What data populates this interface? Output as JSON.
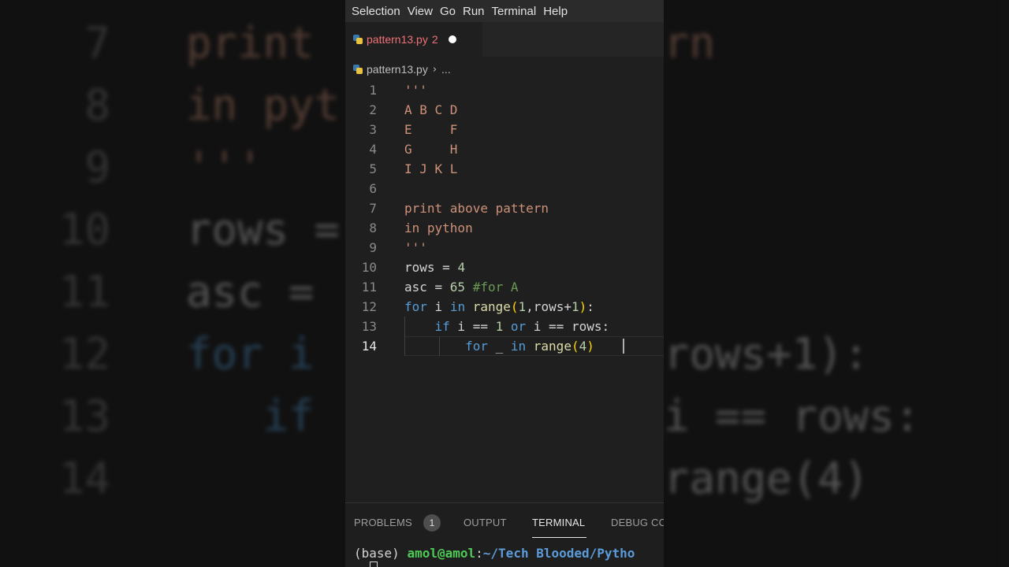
{
  "menu": [
    "Selection",
    "View",
    "Go",
    "Run",
    "Terminal",
    "Help"
  ],
  "tab": {
    "filename": "pattern13.py",
    "problems_count": "2"
  },
  "breadcrumb": {
    "file": "pattern13.py",
    "more": "..."
  },
  "active_line": 14,
  "code_lines": [
    {
      "n": "1",
      "tokens": [
        [
          "s-str",
          "'''"
        ]
      ]
    },
    {
      "n": "2",
      "tokens": [
        [
          "s-str",
          "A B C D"
        ]
      ]
    },
    {
      "n": "3",
      "tokens": [
        [
          "s-str",
          "E     F"
        ]
      ]
    },
    {
      "n": "4",
      "tokens": [
        [
          "s-str",
          "G     H"
        ]
      ]
    },
    {
      "n": "5",
      "tokens": [
        [
          "s-str",
          "I J K L"
        ]
      ]
    },
    {
      "n": "6",
      "tokens": []
    },
    {
      "n": "7",
      "tokens": [
        [
          "s-str",
          "print above pattern"
        ]
      ]
    },
    {
      "n": "8",
      "tokens": [
        [
          "s-str",
          "in python"
        ]
      ]
    },
    {
      "n": "9",
      "tokens": [
        [
          "s-str",
          "'''"
        ]
      ]
    },
    {
      "n": "10",
      "tokens": [
        [
          "s-txt",
          "rows = "
        ],
        [
          "s-num",
          "4"
        ]
      ]
    },
    {
      "n": "11",
      "tokens": [
        [
          "s-txt",
          "asc = "
        ],
        [
          "s-num",
          "65"
        ],
        [
          "s-txt",
          " "
        ],
        [
          "s-com",
          "#for A"
        ]
      ]
    },
    {
      "n": "12",
      "tokens": [
        [
          "s-kw",
          "for"
        ],
        [
          "s-txt",
          " i "
        ],
        [
          "s-kw",
          "in"
        ],
        [
          "s-txt",
          " "
        ],
        [
          "s-fn",
          "range"
        ],
        [
          "s-br1",
          "("
        ],
        [
          "s-num",
          "1"
        ],
        [
          "s-txt",
          ",rows+"
        ],
        [
          "s-num",
          "1"
        ],
        [
          "s-br1",
          ")"
        ],
        [
          "s-txt",
          ":"
        ]
      ]
    },
    {
      "n": "13",
      "tokens": [
        [
          "s-txt",
          "    "
        ],
        [
          "s-kw",
          "if"
        ],
        [
          "s-txt",
          " i == "
        ],
        [
          "s-num",
          "1"
        ],
        [
          "s-txt",
          " "
        ],
        [
          "s-kw",
          "or"
        ],
        [
          "s-txt",
          " i == rows:"
        ]
      ]
    },
    {
      "n": "14",
      "tokens": [
        [
          "s-txt",
          "        "
        ],
        [
          "s-kw",
          "for"
        ],
        [
          "s-txt",
          " _ "
        ],
        [
          "s-kw",
          "in"
        ],
        [
          "s-txt",
          " "
        ],
        [
          "s-fn",
          "range"
        ],
        [
          "s-br1",
          "("
        ],
        [
          "s-num",
          "4"
        ],
        [
          "s-br1",
          ")"
        ]
      ]
    }
  ],
  "panel_tabs": {
    "problems": "PROBLEMS",
    "problems_badge": "1",
    "output": "OUTPUT",
    "terminal": "TERMINAL",
    "debug": "DEBUG CO"
  },
  "terminal": {
    "env": "(base) ",
    "user": "amol@amol",
    "colon": ":",
    "path": "~/Tech Blooded/Pytho"
  },
  "background": {
    "lines": [
      {
        "n": "7",
        "code": "print",
        "right": "rn"
      },
      {
        "n": "8",
        "code": "in pyt",
        "right": ""
      },
      {
        "n": "9",
        "code": "'''",
        "right": ""
      },
      {
        "n": "10",
        "code": "rows =",
        "right": ""
      },
      {
        "n": "11",
        "code": "asc =",
        "right": ""
      },
      {
        "n": "12",
        "code": "for i",
        "right": "rows+1):"
      },
      {
        "n": "13",
        "code": "   if",
        "right": "i == rows:"
      },
      {
        "n": "14",
        "code": "",
        "right": "range(4)"
      }
    ]
  },
  "colors": {
    "editor_bg": "#1f1f1f",
    "string": "#ce9178",
    "keyword": "#569cd6",
    "function": "#dcdcaa",
    "number": "#b5cea8",
    "comment": "#6a9955",
    "bracket": "#ffd700",
    "tab_error": "#f07178",
    "terminal_user": "#4ec955",
    "terminal_path": "#5b9bd9"
  }
}
